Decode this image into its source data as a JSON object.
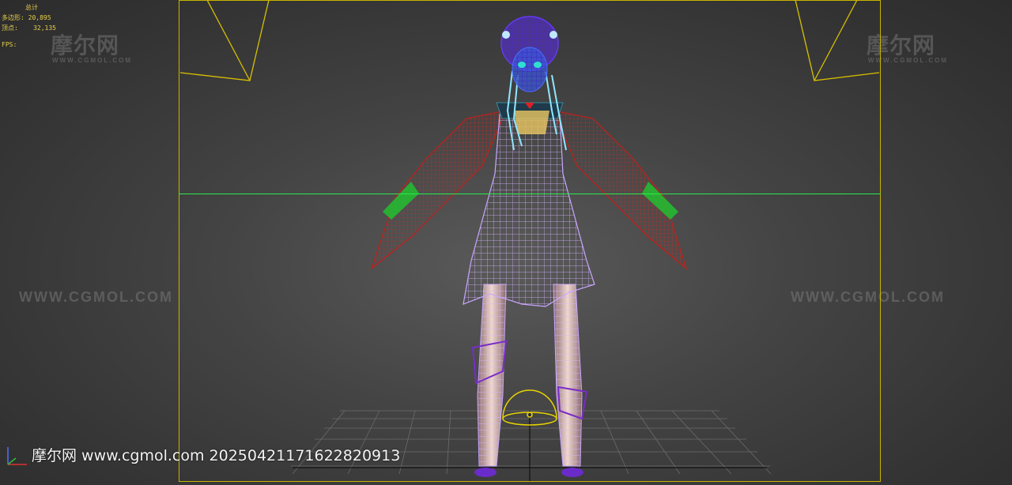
{
  "stats": {
    "header": "总计",
    "polys_label": "多边形:",
    "polys_value": "20,895",
    "verts_label": "顶点:",
    "verts_value": "32,135",
    "fps_label": "FPS:"
  },
  "watermarks": {
    "logo": "摩尔网",
    "sub": "WWW.CGMOL.COM",
    "url": "WWW.CGMOL.COM"
  },
  "caption": "摩尔网 www.cgmol.com 20250421171622820913",
  "colors": {
    "frame": "#c8b400",
    "horizon": "#2ee84a",
    "stats_text": "#e8d04a",
    "mesh_body": "#c9a6ff",
    "mesh_head": "#6a3cff",
    "mesh_hair": "#8fe8ff",
    "mesh_wings": "#c0201a",
    "mesh_wing_tips": "#22c030",
    "mesh_ornament": "#e0c060"
  }
}
